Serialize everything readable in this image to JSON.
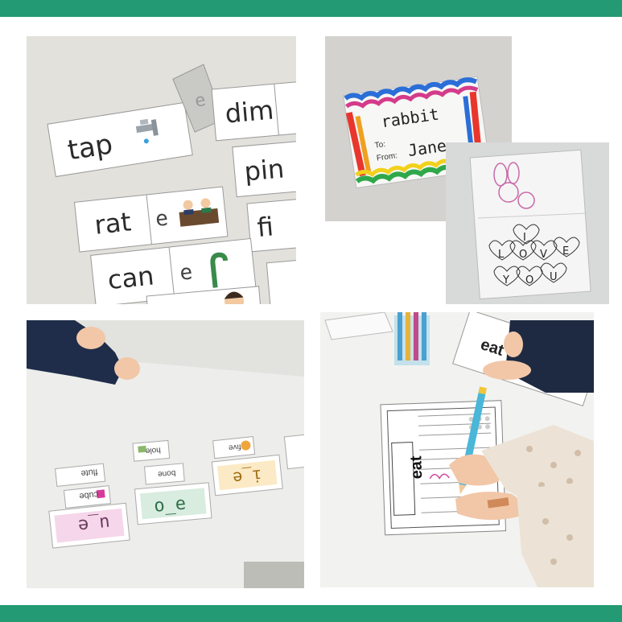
{
  "colors": {
    "band": "#239a73",
    "background": "#ffffff"
  },
  "photo1": {
    "words": [
      "tap",
      "dim",
      "rat",
      "pin",
      "can",
      "fi"
    ],
    "letters": [
      "e",
      "e"
    ],
    "icons": [
      "faucet-icon",
      "judges-icon",
      "candy-cane-icon",
      "face-icon"
    ]
  },
  "photo2": {
    "heading": "rabbit",
    "to_label": "To:",
    "from_label": "From:",
    "from_name": "Jane"
  },
  "photo3": {
    "letters": [
      "I",
      "L",
      "O",
      "V",
      "E",
      "Y",
      "O",
      "U"
    ]
  },
  "photo4": {
    "card_patterns": [
      "u_e",
      "o_e",
      "i_e"
    ],
    "flap_words": [
      "flute",
      "cube",
      "hole",
      "bone",
      "five"
    ]
  },
  "photo5": {
    "worksheet_word": "eat",
    "side_word": "eat"
  }
}
